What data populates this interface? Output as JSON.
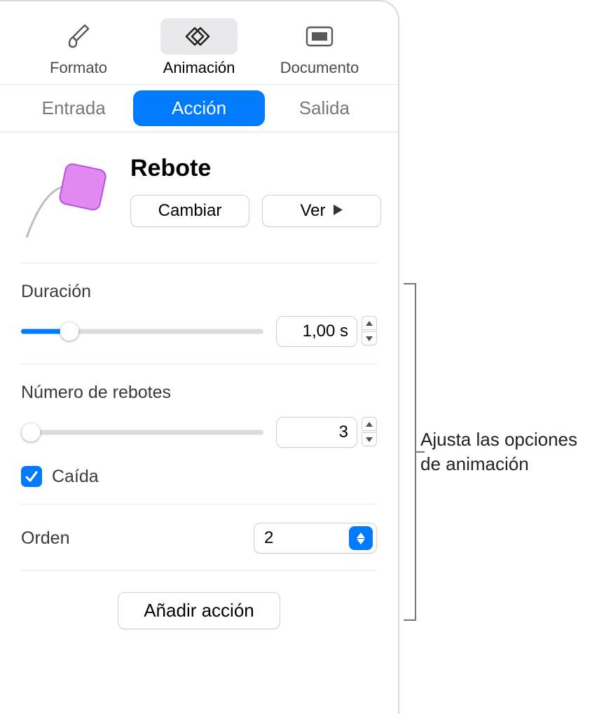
{
  "toolbar": {
    "format": "Formato",
    "animation": "Animación",
    "document": "Documento"
  },
  "tabs": {
    "in": "Entrada",
    "action": "Acción",
    "out": "Salida"
  },
  "effect": {
    "title": "Rebote",
    "change": "Cambiar",
    "preview": "Ver"
  },
  "duration": {
    "label": "Duración",
    "value": "1,00 s",
    "percent": 20
  },
  "bounces": {
    "label": "Número de rebotes",
    "value": "3",
    "percent": 0,
    "decay_label": "Caída",
    "decay_checked": true
  },
  "order": {
    "label": "Orden",
    "value": "2"
  },
  "add_action": "Añadir acción",
  "callout": "Ajusta las opciones de animación"
}
